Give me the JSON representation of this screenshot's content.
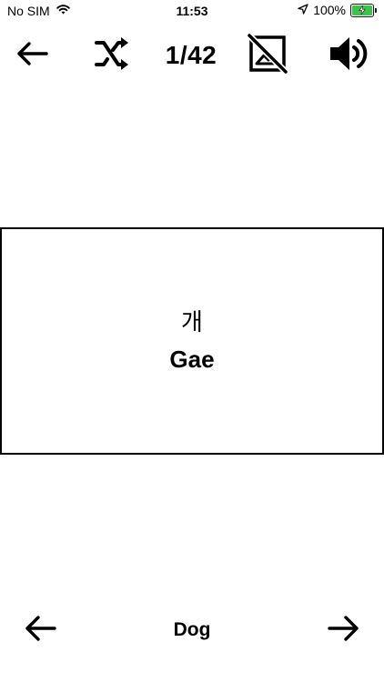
{
  "status_bar": {
    "carrier": "No SIM",
    "time": "11:53",
    "battery_percent": "100%",
    "battery_level": 1.0,
    "icons": [
      "wifi-icon",
      "location-arrow-icon",
      "battery-charging-icon"
    ]
  },
  "toolbar": {
    "counter": "1/42",
    "icons": [
      "arrow-left-icon",
      "shuffle-icon",
      "image-off-icon",
      "speaker-volume-icon"
    ]
  },
  "card": {
    "korean": "개",
    "romanization": "Gae"
  },
  "bottom_nav": {
    "word": "Dog",
    "icons": [
      "arrow-left-icon",
      "arrow-right-icon"
    ]
  },
  "colors": {
    "battery_fill": "#3bc34a",
    "text": "#000000",
    "background": "#ffffff"
  }
}
